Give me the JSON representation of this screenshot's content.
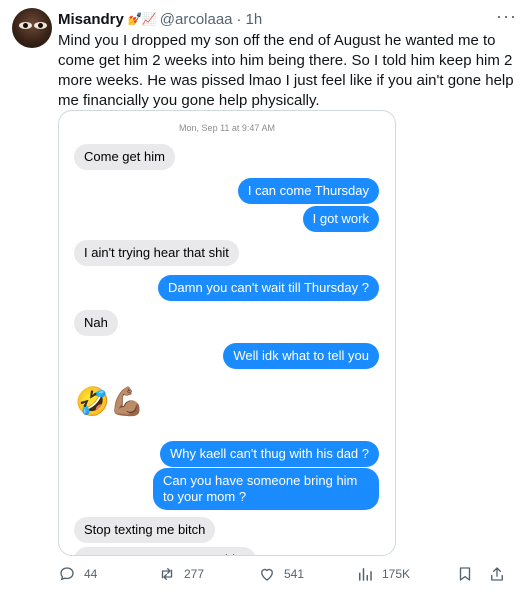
{
  "author": {
    "name": "Misandry",
    "name_emoji": "💅📈",
    "handle": "@arcolaaa",
    "separator": "·",
    "time": "1h"
  },
  "tweet_text": "Mind you I dropped my son off the end of August he wanted me to come get him 2 weeks into him being there. So I told him keep him 2 more weeks. He was pissed lmao I just feel like if you ain't gone help me financially you gone help physically.",
  "screenshot": {
    "timestamp": "Mon, Sep 11 at 9:47 AM",
    "messages": [
      {
        "side": "in",
        "text": "Come get him"
      },
      {
        "side": "out",
        "text": "I can come Thursday"
      },
      {
        "side": "out",
        "text": "I got work"
      },
      {
        "side": "in",
        "text": "I ain't trying hear that shit"
      },
      {
        "side": "out",
        "text": "Damn you can't wait till Thursday ?"
      },
      {
        "side": "in",
        "text": "Nah"
      },
      {
        "side": "out",
        "text": "Well idk what to tell you"
      },
      {
        "side": "in",
        "text": "🤣💪🏽"
      },
      {
        "side": "out",
        "text": "Why kaell can't thug with his dad ?"
      },
      {
        "side": "out",
        "text": "Can you have someone bring him to your mom ?"
      },
      {
        "side": "in",
        "text": "Stop texting me bitch"
      },
      {
        "side": "in",
        "text": "Have ya mom come get him"
      }
    ]
  },
  "actions": {
    "replies": "44",
    "retweets": "277",
    "likes": "541",
    "views": "175K"
  },
  "colors": {
    "accent": "#1d9bf0",
    "imessage_blue": "#1b8cff",
    "muted": "#536471"
  }
}
